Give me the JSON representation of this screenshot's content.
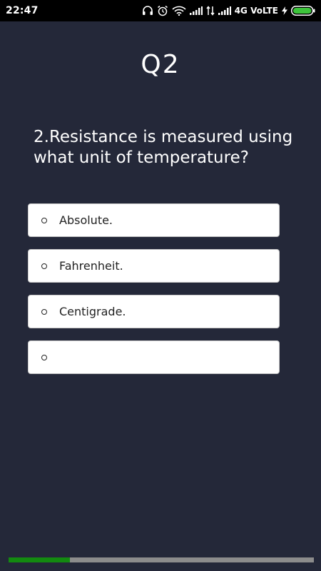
{
  "status_bar": {
    "time": "22:47",
    "network": "4G VoLTE"
  },
  "quiz": {
    "title": "Q2",
    "question": "2.Resistance is measured using what unit of temperature?",
    "options": [
      {
        "label": "Absolute."
      },
      {
        "label": "Fahrenheit."
      },
      {
        "label": "Centigrade."
      },
      {
        "label": ""
      }
    ]
  },
  "progress": {
    "fraction": 0.2
  },
  "colors": {
    "background": "#242839",
    "progress_fill": "#138a10",
    "progress_track": "#8c8c8c"
  },
  "icons": [
    "headphones-icon",
    "alarm-icon",
    "wifi-icon",
    "signal-icon",
    "data-arrows-icon",
    "battery-charging-icon"
  ]
}
